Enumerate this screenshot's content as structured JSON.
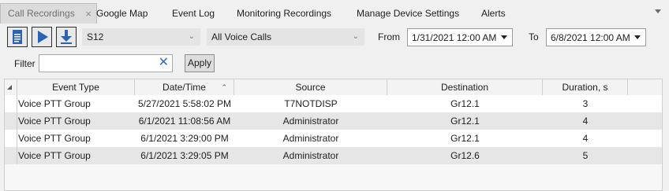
{
  "tabs": [
    {
      "label": "Call Recordings",
      "active": true
    },
    {
      "label": "Google Map"
    },
    {
      "label": "Event Log"
    },
    {
      "label": "Monitoring Recordings"
    },
    {
      "label": "Manage Device Settings"
    },
    {
      "label": "Alerts"
    }
  ],
  "tab_close_glyph": "×",
  "toolbar": {
    "device": "S12",
    "call_type": "All Voice Calls",
    "from_label": "From",
    "from_value": "1/31/2021 12:00 AM",
    "to_label": "To",
    "to_value": "6/8/2021 12:00 AM",
    "accent_color": "#2b63b3"
  },
  "filter": {
    "label": "Filter",
    "value": "",
    "apply_label": "Apply"
  },
  "table": {
    "columns": [
      "Event Type",
      "Date/Time",
      "Source",
      "Destination",
      "Duration, s"
    ],
    "rows": [
      [
        "Voice PTT Group",
        "5/27/2021 5:58:02 PM",
        "T7NOTDISP",
        "Gr12.1",
        "3"
      ],
      [
        "Voice PTT Group",
        "6/1/2021 11:08:56 AM",
        "Administrator",
        "Gr12.1",
        "4"
      ],
      [
        "Voice PTT Group",
        "6/1/2021 3:29:00 PM",
        "Administrator",
        "Gr12.1",
        "4"
      ],
      [
        "Voice PTT Group",
        "6/1/2021 3:29:05 PM",
        "Administrator",
        "Gr12.6",
        "5"
      ]
    ]
  }
}
